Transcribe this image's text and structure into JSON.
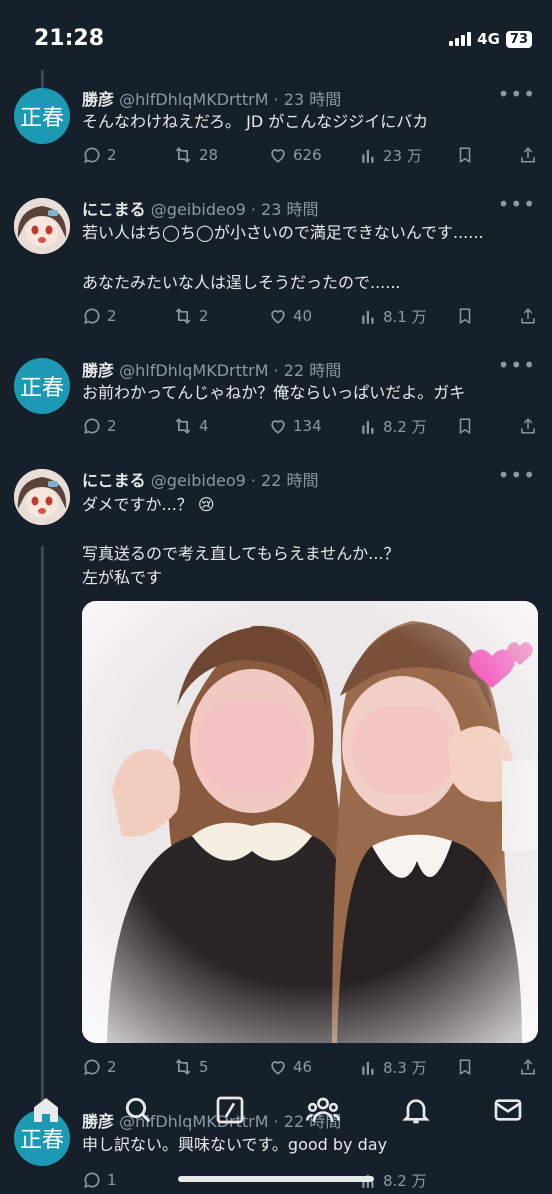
{
  "status": {
    "time": "21:28",
    "network": "4G",
    "battery": "73"
  },
  "tweets": [
    {
      "avatar_text": "正春",
      "name": "勝彦",
      "meta": "@hlfDhlqMKDrttrM · 23 時間",
      "lines": [
        "そんなわけねえだろ。 JD がこんなジジイにバカ"
      ],
      "replies": "2",
      "retweets": "28",
      "likes": "626",
      "views": "23 万"
    },
    {
      "name": "にこまる",
      "meta": "@geibideo9 · 23 時間",
      "lines": [
        "若い人はち◯ち◯が小さいので満足できないんです......",
        "あなたみたいな人は逞しそうだったので......"
      ],
      "replies": "2",
      "retweets": "2",
      "likes": "40",
      "views": "8.1 万"
    },
    {
      "avatar_text": "正春",
      "name": "勝彦",
      "meta": "@hlfDhlqMKDrttrM · 22 時間",
      "lines": [
        "お前わかってんじゃねか？俺ならいっぱいだよ。ガキ"
      ],
      "replies": "2",
      "retweets": "4",
      "likes": "134",
      "views": "8.2 万"
    },
    {
      "name": "にこまる",
      "meta": "@geibideo9 · 22 時間",
      "lines": [
        "ダメですか...？ 😢",
        "写真送るので考え直してもらえませんか...？",
        "左が私です"
      ],
      "replies": "2",
      "retweets": "5",
      "likes": "46",
      "views": "8.3 万"
    },
    {
      "avatar_text": "正春",
      "name": "勝彦",
      "meta": "@hlfDhlqMKDrttrM · 22 時間",
      "lines": [
        "申し訳ない。興味ないです。good by day"
      ],
      "replies": "1",
      "views": "8.2 万"
    }
  ],
  "icons": {
    "more": "more-icon",
    "reply": "reply-icon",
    "retweet": "retweet-icon",
    "like": "heart-icon",
    "views": "views-icon",
    "bookmark": "bookmark-icon",
    "share": "share-icon",
    "tabs": [
      "home-icon",
      "search-icon",
      "compose-icon",
      "communities-icon",
      "notifications-icon",
      "messages-icon"
    ]
  },
  "colors": {
    "background": "#15202b",
    "text": "#e7e9ea",
    "muted": "#8b98a5",
    "avatar": "#1c9ab4",
    "line": "#3b4754"
  }
}
